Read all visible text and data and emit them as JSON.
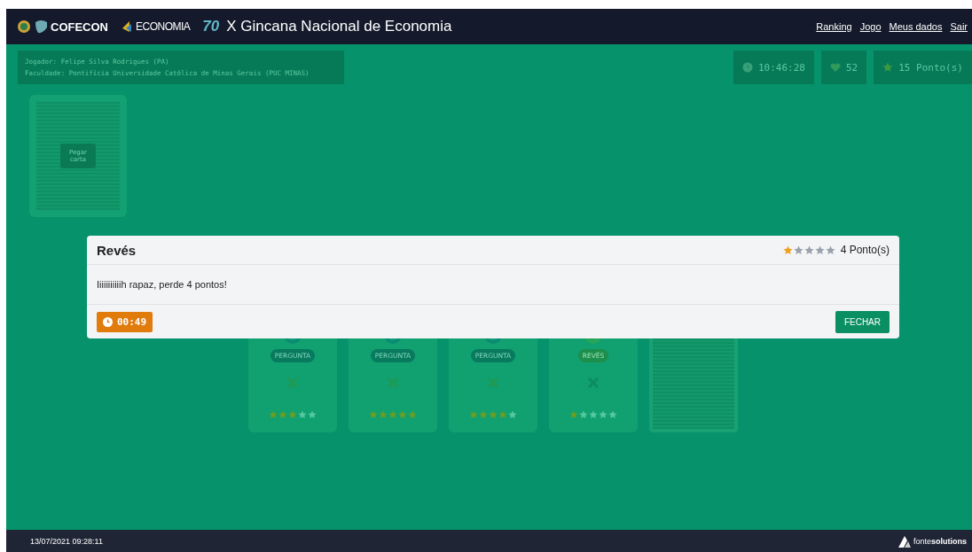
{
  "header": {
    "logos": [
      "COFECON",
      "ECONOMIA",
      "70"
    ],
    "title": "X Gincana Nacional de Economia",
    "links": [
      "Ranking",
      "Jogo",
      "Meus dados",
      "Sair"
    ]
  },
  "player": {
    "name": "Jogador: Felipe Silva Rodrigues (PA)",
    "school": "Faculdade: Pontifícia Universidade Católica de Minas Gerais (PUC MINAS)"
  },
  "stats": [
    {
      "kind": "clock",
      "value": "10:46:28"
    },
    {
      "kind": "heart",
      "value": "52"
    },
    {
      "kind": "star",
      "value": "15 Ponto(s)"
    }
  ],
  "deck": {
    "label": "Pegar carta"
  },
  "cards": [
    {
      "kind": "pergunta",
      "label": "PERGUNTA",
      "stars": 3
    },
    {
      "kind": "pergunta",
      "label": "PERGUNTA",
      "stars": 5
    },
    {
      "kind": "pergunta",
      "label": "PERGUNTA",
      "stars": 4
    },
    {
      "kind": "reves",
      "label": "REVÉS",
      "stars": 1
    }
  ],
  "modal": {
    "title": "Revés",
    "stars": 1,
    "points": "4 Ponto(s)",
    "message": "Iiiiiiiiiiih rapaz, perde 4 pontos!",
    "timer": "00:49",
    "button": "FECHAR"
  },
  "footer": {
    "datetime": "13/07/2021 09:28:11",
    "brand_light": "fonte",
    "brand_bold": "solutions"
  }
}
